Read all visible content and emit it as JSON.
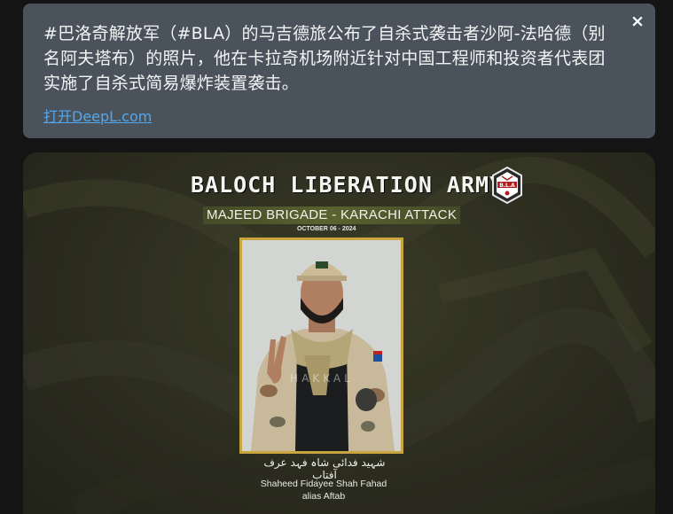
{
  "popup": {
    "translation": "#巴洛奇解放军（#BLA）的马吉德旅公布了自杀式袭击者沙阿-法哈德（别名阿夫塔布）的照片，他在卡拉奇机场附近针对中国工程师和投资者代表团实施了自杀式简易爆炸装置袭击。",
    "link_label": "打开DeepL.com",
    "close_label": "×",
    "close_icon": "close-icon"
  },
  "poster": {
    "title": "BALOCH LIBERATION ARMY",
    "logo_text": "B.L.A",
    "subtitle": "MAJEED BRIGADE - KARACHI ATTACK",
    "date": "OCTOBER 06 - 2024",
    "watermark": "HAKKAL",
    "urdu_caption": "شہید فدائی شاہ فہد عرف آفتاب",
    "caption_line1": "Shaheed Fidayee Shah Fahad",
    "caption_line2": "alias Aftab"
  },
  "colors": {
    "popup_bg": "#4a525b",
    "link": "#52a8ee",
    "frame_gold": "#c9a53f",
    "card_bg": "#2c2d1f"
  }
}
